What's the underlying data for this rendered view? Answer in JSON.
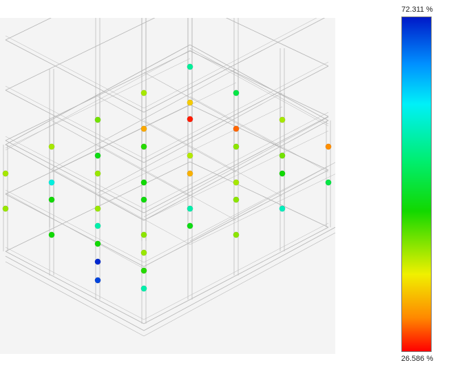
{
  "legend": {
    "max_label": "72.311 %",
    "min_label": "26.586 %",
    "max_value": 72.311,
    "min_value": 26.586,
    "gradient": [
      "#0019c8",
      "#0090ff",
      "#00f0f8",
      "#00ee70",
      "#12d800",
      "#f0f000",
      "#ff8800",
      "#ff0000"
    ]
  },
  "colors": {
    "viewport_background": "#f4f4f4",
    "frame_lines": "#b4b4b4"
  },
  "probe_points": [
    {
      "id": "p01",
      "value": 55.0
    },
    {
      "id": "p02",
      "value": 40.0
    },
    {
      "id": "p03",
      "value": 50.0
    },
    {
      "id": "p04",
      "value": 27.5
    },
    {
      "id": "p05",
      "value": 35.0
    },
    {
      "id": "p06",
      "value": 30.0
    },
    {
      "id": "p07",
      "value": 40.0
    },
    {
      "id": "p08",
      "value": 42.0
    },
    {
      "id": "p09",
      "value": 33.0
    },
    {
      "id": "p10",
      "value": 40.0
    },
    {
      "id": "p11",
      "value": 47.0
    },
    {
      "id": "p12",
      "value": 45.0
    },
    {
      "id": "p13",
      "value": 39.5
    },
    {
      "id": "p14",
      "value": 41.0
    },
    {
      "id": "p15",
      "value": 42.0
    },
    {
      "id": "p16",
      "value": 31.5
    },
    {
      "id": "p17",
      "value": 40.0
    },
    {
      "id": "p18",
      "value": 59.0
    },
    {
      "id": "p19",
      "value": 40.5
    },
    {
      "id": "p20",
      "value": 46.0
    },
    {
      "id": "p21",
      "value": 33.5
    },
    {
      "id": "p22",
      "value": 40.0
    },
    {
      "id": "p23",
      "value": 46.0
    },
    {
      "id": "p24",
      "value": 50.0
    },
    {
      "id": "p25",
      "value": 40.5
    },
    {
      "id": "p26",
      "value": 46.0
    },
    {
      "id": "p27",
      "value": 40.5
    },
    {
      "id": "p28",
      "value": 46.5
    },
    {
      "id": "p29",
      "value": 56.0
    },
    {
      "id": "p30",
      "value": 41.0
    },
    {
      "id": "p31",
      "value": 57.0
    },
    {
      "id": "p32",
      "value": 46.0
    },
    {
      "id": "p33",
      "value": 56.0
    },
    {
      "id": "p34",
      "value": 41.0
    },
    {
      "id": "p35",
      "value": 47.0
    },
    {
      "id": "p36",
      "value": 41.0
    },
    {
      "id": "p37",
      "value": 46.0
    },
    {
      "id": "p38",
      "value": 40.5
    },
    {
      "id": "p39",
      "value": 71.5
    },
    {
      "id": "p40",
      "value": 45.0
    },
    {
      "id": "p41",
      "value": 70.0
    },
    {
      "id": "p42",
      "value": 56.0
    }
  ]
}
